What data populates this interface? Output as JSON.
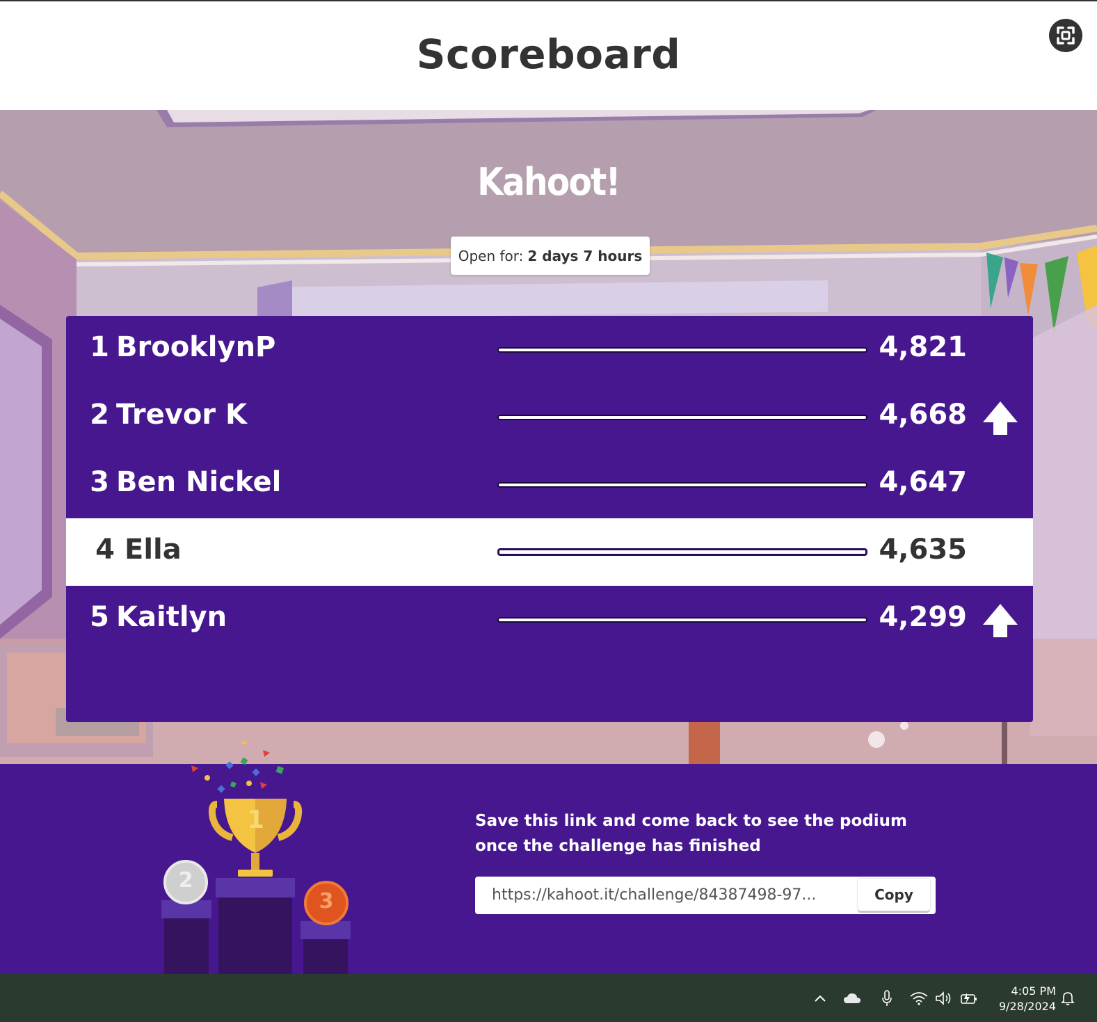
{
  "header": {
    "title": "Scoreboard",
    "fullscreen_icon": "fullscreen-icon"
  },
  "brand": {
    "logo": "Kahoot!"
  },
  "status": {
    "open_for_label": "Open for:",
    "open_for_value": "2 days 7 hours"
  },
  "leaderboard": {
    "rows": [
      {
        "rank": "1",
        "name": "BrooklynP",
        "score": "4,821",
        "arrow_up": false,
        "highlight": false
      },
      {
        "rank": "2",
        "name": "Trevor K",
        "score": "4,668",
        "arrow_up": true,
        "highlight": false
      },
      {
        "rank": "3",
        "name": "Ben Nickel",
        "score": "4,647",
        "arrow_up": false,
        "highlight": false
      },
      {
        "rank": "4",
        "name": "Ella",
        "score": "4,635",
        "arrow_up": false,
        "highlight": true
      },
      {
        "rank": "5",
        "name": "Kaitlyn",
        "score": "4,299",
        "arrow_up": true,
        "highlight": false
      }
    ]
  },
  "footer": {
    "message_line1": "Save this link and come back to see the podium",
    "message_line2": "once the challenge has finished",
    "link": "https://kahoot.it/challenge/84387498-97...",
    "copy_label": "Copy",
    "podium_labels": [
      "1",
      "2",
      "3"
    ]
  },
  "taskbar": {
    "time": "4:05 PM",
    "date": "9/28/2024",
    "icons": [
      "chevron-up-icon",
      "cloud-icon",
      "microphone-icon",
      "wifi-icon",
      "volume-icon",
      "battery-icon",
      "notification-bell-icon"
    ]
  },
  "colors": {
    "purple": "#46178f",
    "white": "#ffffff",
    "text_dark": "#333333",
    "taskbar": "#2b3a2e"
  }
}
